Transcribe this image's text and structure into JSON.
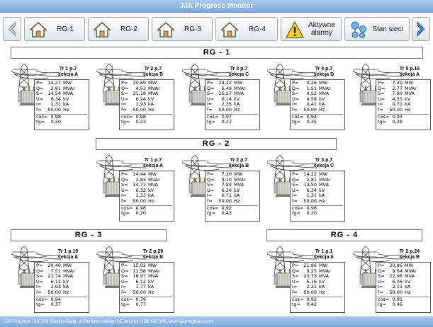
{
  "app": {
    "title": "JJA Progress Monitor"
  },
  "nav": {
    "buttons": [
      {
        "label": "RG-1"
      },
      {
        "label": "RG-2"
      },
      {
        "label": "RG-3"
      },
      {
        "label": "RG-4"
      },
      {
        "label": "Aktywne alarmy"
      },
      {
        "label": "Stan sieci"
      }
    ]
  },
  "groups": [
    {
      "title": "RG - 1"
    },
    {
      "title": "RG - 2"
    },
    {
      "title": "RG - 3"
    },
    {
      "title": "RG - 4"
    }
  ],
  "labels": {
    "P": "P=",
    "Q": "Q=",
    "S": "S=",
    "U": "U=",
    "I": "I=",
    "f": "f=",
    "cos": "cos=",
    "tg": "tg="
  },
  "units_of_measure": {
    "P": "MW",
    "Q": "MVAr",
    "S": "MVA",
    "U": "kV",
    "I": "kA",
    "f": "Hz"
  },
  "units": [
    {
      "name": "Tr 1 p.7",
      "section": "sekcja A",
      "P": "14,27",
      "Q": "2,81",
      "S": "14,54",
      "U": "6,34",
      "I": "1,31",
      "f": "50,00",
      "cos": "0,98",
      "tg": "0,20"
    },
    {
      "name": "Tr 2 p.7",
      "section": "sekcja B",
      "P": "20,69",
      "Q": "4,53",
      "S": "21,18",
      "U": "6,24",
      "I": "1,93",
      "f": "50,00",
      "cos": "0,98",
      "tg": "0,22"
    },
    {
      "name": "Tr 3 p.7",
      "section": "sekcja C",
      "P": "24,42",
      "Q": "6,49",
      "S": "25,27",
      "U": "6,14",
      "I": "2,35",
      "f": "50,00",
      "cos": "0,97",
      "tg": "0,27"
    },
    {
      "name": "Tr 4 p.7",
      "section": "sekcja D",
      "P": "4,26",
      "Q": "1,51",
      "S": "4,52",
      "U": "4,58",
      "I": "0,41",
      "f": "50,00",
      "cos": "0,94",
      "tg": "0,35"
    },
    {
      "name": "Tr 5 p.16",
      "section": "sekcja A",
      "P": "7,29",
      "Q": "2,77",
      "S": "7,80",
      "U": "4,55",
      "I": "0,71",
      "f": "50,00",
      "cos": "0,93",
      "tg": "0,38"
    },
    {
      "name": "Tr 1 p.7",
      "section": "sekcja A",
      "P": "14,44",
      "Q": "2,83",
      "S": "14,71",
      "U": "6,32",
      "I": "1,33",
      "f": "50,00",
      "cos": "0,98",
      "tg": "0,20"
    },
    {
      "name": "Tr 2 p.7",
      "section": "sekcja B",
      "P": "7,20",
      "Q": "3,10",
      "S": "7,84",
      "U": "6,36",
      "I": "0,71",
      "f": "50,00",
      "cos": "0,92",
      "tg": "0,43"
    },
    {
      "name": "Tr 3 p.7",
      "section": "sekcja C",
      "P": "14,22",
      "Q": "2,81",
      "S": "14,50",
      "U": "6,34",
      "I": "1,31",
      "f": "50,00",
      "cos": "0,98",
      "tg": "0,20"
    },
    {
      "name": "Tr 1 p.19",
      "section": "sekcja A",
      "P": "20,40",
      "Q": "7,51",
      "S": "21,74",
      "U": "6,12",
      "I": "2,03",
      "f": "50,00",
      "cos": "0,94",
      "tg": "0,37"
    },
    {
      "name": "Tr 2 p.29",
      "section": "sekcja B",
      "P": "15,02",
      "Q": "11,58",
      "S": "18,97",
      "U": "6,12",
      "I": "1,77",
      "f": "50,00",
      "cos": "0,79",
      "tg": "0,77"
    },
    {
      "name": "Tr 1 p.1",
      "section": "sekcja A",
      "P": "21,86",
      "Q": "9,25",
      "S": "23,73",
      "U": "6,16",
      "I": "2,21",
      "f": "50,00",
      "cos": "0,92",
      "tg": "0,42"
    },
    {
      "name": "Tr 2 p.24",
      "section": "sekcja B",
      "P": "20,86",
      "Q": "9,64",
      "S": "22,98",
      "U": "6,06",
      "I": "2,15",
      "f": "50,00",
      "cos": "0,91",
      "tg": "0,46"
    }
  ],
  "footer": {
    "text": "JJA Progress, 43-300 Bielsko-Biała, ul.Poniatowskiego 25, tel./fax: 338 142 143,  www.jjaprogress.com"
  },
  "colors": {
    "title_bar": "#7ba8e0",
    "nav_arrow": "#4a7fd0",
    "alarm_yellow": "#f2d21b"
  }
}
